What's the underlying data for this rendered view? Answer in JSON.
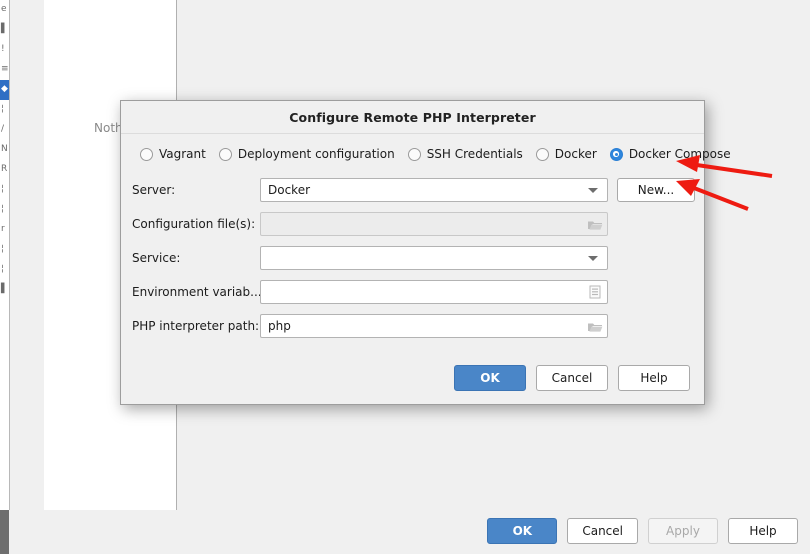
{
  "background_window": {
    "empty_message": "Nothing to sh",
    "tree_rows": [
      {
        "glyph": "e",
        "selected": false
      },
      {
        "glyph": "▌",
        "selected": false
      },
      {
        "glyph": "!",
        "selected": false
      },
      {
        "glyph": "≡",
        "selected": false
      },
      {
        "glyph": "◆",
        "selected": true
      },
      {
        "glyph": "¦",
        "selected": false
      },
      {
        "glyph": "/",
        "selected": false
      },
      {
        "glyph": "N",
        "selected": false
      },
      {
        "glyph": "R",
        "selected": false
      },
      {
        "glyph": "¦",
        "selected": false
      },
      {
        "glyph": "¦",
        "selected": false
      },
      {
        "glyph": "r",
        "selected": false
      },
      {
        "glyph": "¦",
        "selected": false
      },
      {
        "glyph": "¦",
        "selected": false
      },
      {
        "glyph": "▌",
        "selected": false
      }
    ],
    "buttons": {
      "ok": "OK",
      "cancel": "Cancel",
      "apply": "Apply",
      "help": "Help"
    }
  },
  "dialog": {
    "title": "Configure Remote PHP Interpreter",
    "radio_group": {
      "options": [
        {
          "label": "Vagrant",
          "checked": false
        },
        {
          "label": "Deployment configuration",
          "checked": false
        },
        {
          "label": "SSH Credentials",
          "checked": false
        },
        {
          "label": "Docker",
          "checked": false
        },
        {
          "label": "Docker Compose",
          "checked": true
        }
      ]
    },
    "fields": {
      "server": {
        "label": "Server:",
        "value": "Docker",
        "new_button": "New..."
      },
      "config_files": {
        "label": "Configuration file(s):",
        "value": "",
        "placeholder": "",
        "icon": "folder-icon",
        "disabled": true
      },
      "service": {
        "label": "Service:",
        "value": "",
        "placeholder": ""
      },
      "environment_variables": {
        "label": "Environment variab...",
        "value": "",
        "placeholder": "",
        "icon": "list-editor-icon"
      },
      "php_interpreter_path": {
        "label": "PHP interpreter path:",
        "value": "php",
        "placeholder": "",
        "icon": "folder-icon"
      }
    },
    "buttons": {
      "ok": "OK",
      "cancel": "Cancel",
      "help": "Help"
    }
  },
  "annotations": {
    "arrow_color": "#ee1b11",
    "arrows": [
      {
        "name": "arrow-to-docker-compose",
        "target": "Docker Compose"
      },
      {
        "name": "arrow-to-new-button",
        "target": "New..."
      }
    ]
  },
  "colors": {
    "accent_blue": "#4a86c8",
    "radio_selected": "#2f86dd",
    "dialog_bg": "#f0f0f0",
    "tree_selection": "#2f6fc4"
  }
}
